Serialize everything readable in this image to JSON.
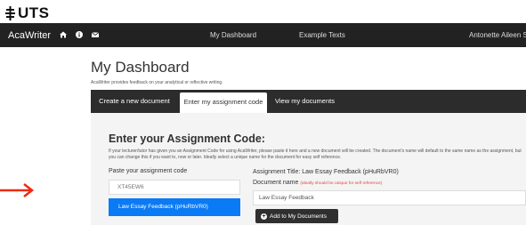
{
  "header": {
    "logo_text": "UTS"
  },
  "navbar": {
    "brand": "AcaWriter",
    "icons": [
      "home-icon",
      "info-icon",
      "mail-icon"
    ],
    "links": {
      "dashboard": "My Dashboard",
      "examples": "Example Texts"
    },
    "user": "Antonette Aileen S"
  },
  "page": {
    "title": "My Dashboard",
    "subtitle": "AcaWriter provides feedback on your analytical or reflective writing."
  },
  "tabs": [
    {
      "label": "Create a new document"
    },
    {
      "label": "Enter my assignment code",
      "active": true
    },
    {
      "label": "View my documents"
    }
  ],
  "assignment": {
    "heading": "Enter your Assignment Code:",
    "description": "If your lecturer/tutor has given you an Assignment Code for using AcaWriter, please paste it here and a new document will be created. The document's name will default to the same name as the assignment, but you can change this if you want to, now or later. Ideally select a unique name for the document for easy self reference.",
    "code_label": "Paste your assignment code",
    "code_placeholder": "XT45EW6",
    "code_result": "Law Essay Feedback (pHuRbVR0)",
    "title_text": "Assignment Title: Law Essay Feedback (pHuRbVR0)",
    "docname_label": "Document name",
    "docname_hint": "(ideally should be unique for self reference)",
    "docname_value": "Law Essay Feedback",
    "add_button": "Add to My Documents"
  },
  "colors": {
    "navbar": "#222222",
    "tabs": "#2c2c2c",
    "primary": "#0a7af5",
    "hint": "#e0463c",
    "annotation_arrow": "#ee2a12"
  }
}
